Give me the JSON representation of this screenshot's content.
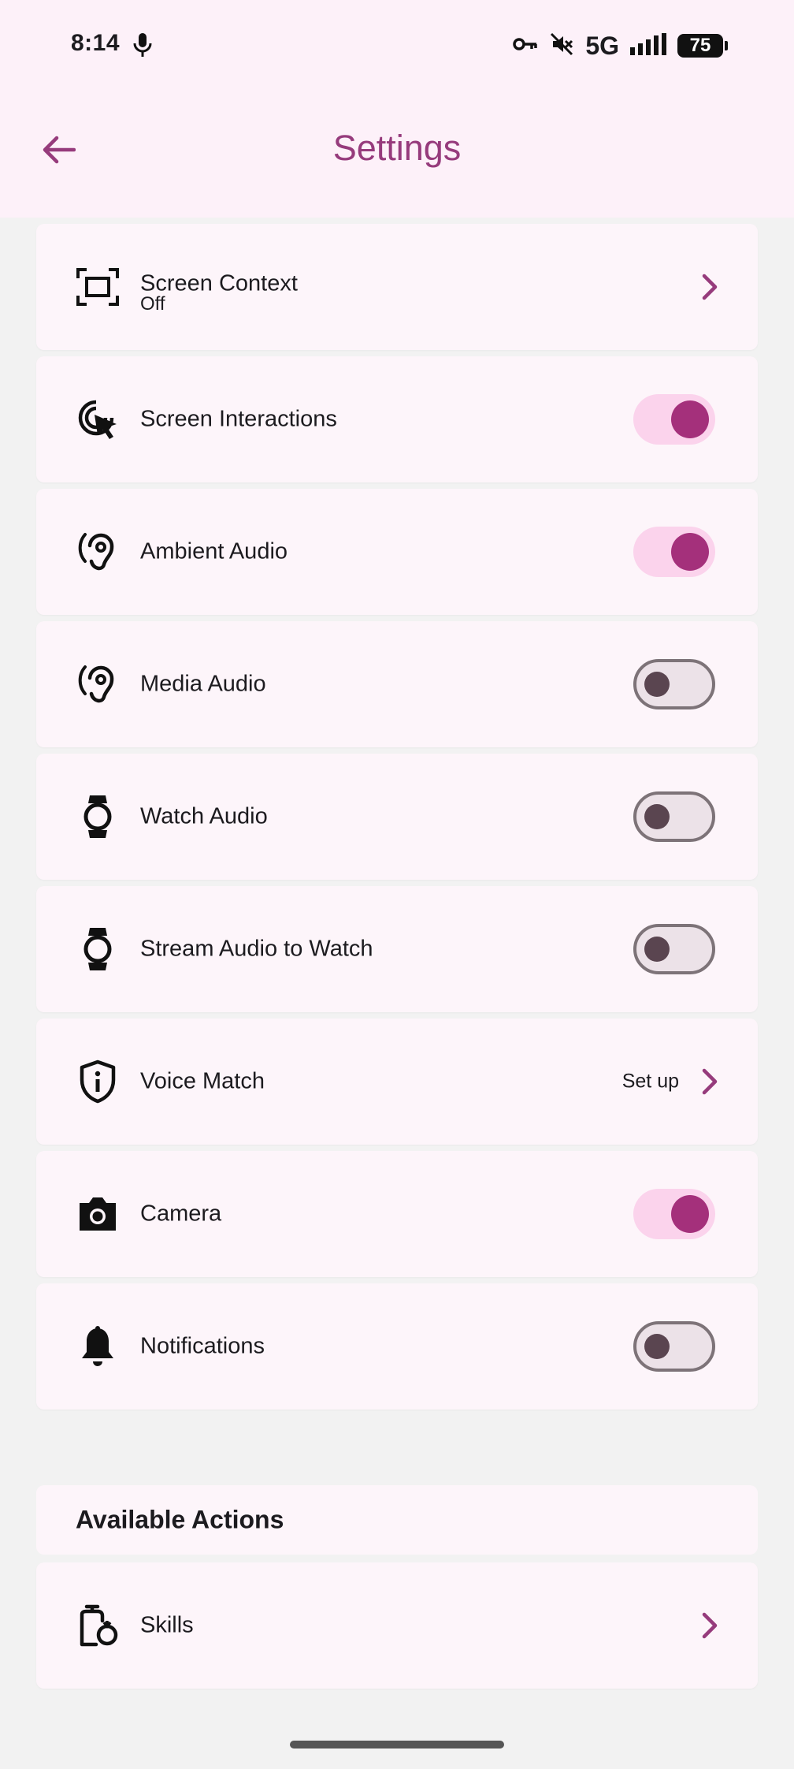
{
  "status": {
    "time": "8:14",
    "network": "5G",
    "battery": "75"
  },
  "header": {
    "title": "Settings"
  },
  "settings": [
    {
      "label": "Screen Context",
      "sublabel": "Off",
      "control": "chevron"
    },
    {
      "label": "Screen Interactions",
      "control": "toggle",
      "on": true
    },
    {
      "label": "Ambient Audio",
      "control": "toggle",
      "on": true
    },
    {
      "label": "Media Audio",
      "control": "toggle",
      "on": false
    },
    {
      "label": "Watch Audio",
      "control": "toggle",
      "on": false
    },
    {
      "label": "Stream Audio to Watch",
      "control": "toggle",
      "on": false
    },
    {
      "label": "Voice Match",
      "action_text": "Set up",
      "control": "chevron"
    },
    {
      "label": "Camera",
      "control": "toggle",
      "on": true
    },
    {
      "label": "Notifications",
      "control": "toggle",
      "on": false
    }
  ],
  "available_actions": {
    "title": "Available Actions",
    "items": [
      {
        "label": "Skills",
        "control": "chevron"
      }
    ]
  },
  "colors": {
    "accent": "#963b7c",
    "toggle_on": "#a4307b",
    "toggle_on_track": "#fbd3ec",
    "card_bg": "#fdf5fa"
  }
}
